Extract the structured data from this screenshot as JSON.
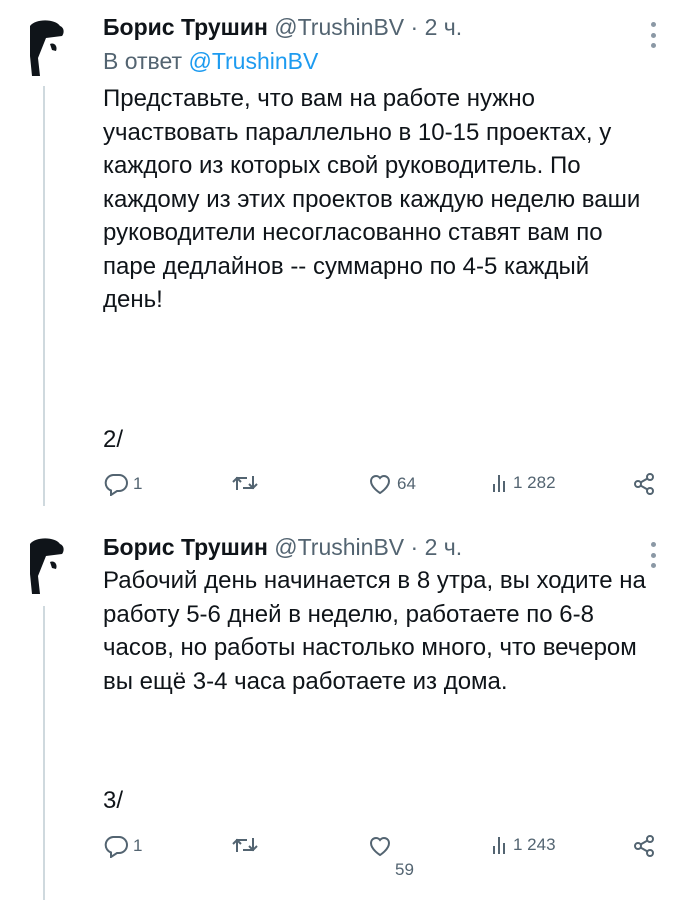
{
  "tweets": [
    {
      "author_name": "Борис Трушин",
      "handle": "@TrushinBV",
      "separator": "·",
      "time": "2 ч.",
      "reply_prefix": "В ответ",
      "reply_to": "@TrushinBV",
      "text": "Представьте, что вам на работе нужно участвовать параллельно в 10-15 проектах, у каждого из которых свой руководитель. По каждому из этих проектов каждую неделю ваши руководители несогласованно ставят вам по паре дедлайнов -- суммарно по 4-5 каждый день!",
      "counter": "2/",
      "replies": "1",
      "retweets": "",
      "likes": "64",
      "views": "1 282",
      "icons": [
        "reply-icon",
        "retweet-icon",
        "like-icon",
        "views-icon",
        "share-icon",
        "more-icon"
      ]
    },
    {
      "author_name": "Борис Трушин",
      "handle": "@TrushinBV",
      "separator": "·",
      "time": "2 ч.",
      "text": "Рабочий день начинается в 8 утра, вы ходите на работу 5-6 дней в неделю, работаете по 6-8 часов, но работы настолько много, что вечером вы ещё 3-4 часа работаете из дома.",
      "counter": "3/",
      "replies": "1",
      "retweets": "",
      "likes": "59",
      "views": "1 243",
      "icons": [
        "reply-icon",
        "retweet-icon",
        "like-icon",
        "views-icon",
        "share-icon",
        "more-icon"
      ]
    }
  ],
  "colors": {
    "text": "#0f1419",
    "muted": "#536471",
    "link": "#1d9bf0",
    "thread_line": "#cfd9de"
  }
}
